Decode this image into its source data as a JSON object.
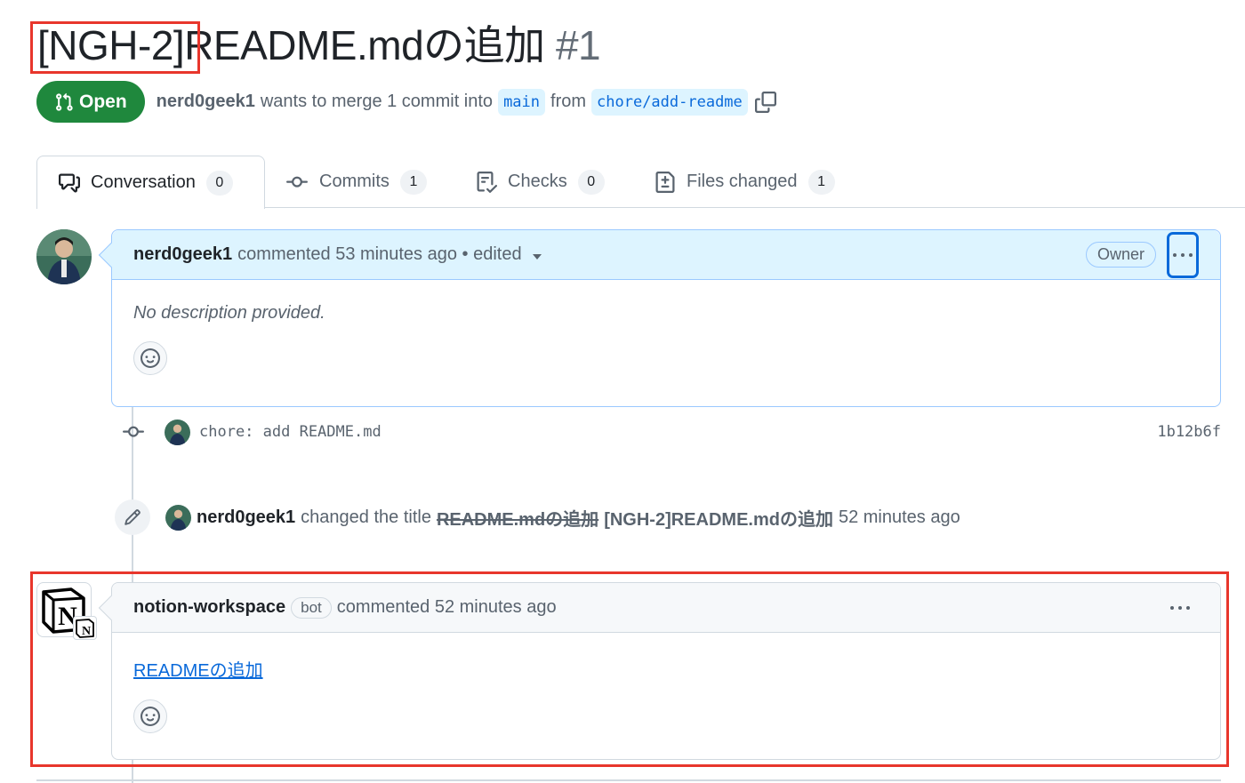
{
  "pr": {
    "title_key": "[NGH-2]",
    "title_rest": "README.mdの追加",
    "number": "#1",
    "status": "Open",
    "author": "nerd0geek1",
    "merge_text": "wants to merge 1 commit into",
    "base_branch": "main",
    "from_text": "from",
    "head_branch": "chore/add-readme"
  },
  "tabs": [
    {
      "label": "Conversation",
      "count": "0",
      "icon": "comment-discussion-icon",
      "active": true
    },
    {
      "label": "Commits",
      "count": "1",
      "icon": "git-commit-icon"
    },
    {
      "label": "Checks",
      "count": "0",
      "icon": "checklist-icon"
    },
    {
      "label": "Files changed",
      "count": "1",
      "icon": "file-diff-icon"
    }
  ],
  "timeline": {
    "first_comment": {
      "author": "nerd0geek1",
      "meta": "commented 53 minutes ago • edited",
      "role_badge": "Owner",
      "body": "No description provided."
    },
    "commit": {
      "message": "chore: add README.md",
      "sha": "1b12b6f"
    },
    "rename": {
      "actor": "nerd0geek1",
      "action": "changed the title",
      "old_title": "README.mdの追加",
      "new_title": "[NGH-2]README.mdの追加",
      "time": "52 minutes ago"
    },
    "bot_comment": {
      "author": "notion-workspace",
      "badge": "bot",
      "meta": "commented 52 minutes ago",
      "link_text": "READMEの追加"
    }
  },
  "colors": {
    "open_green": "#1f883d",
    "link_blue": "#0969da",
    "highlight_red": "#e8362c",
    "owner_header_bg": "#ddf4ff"
  }
}
